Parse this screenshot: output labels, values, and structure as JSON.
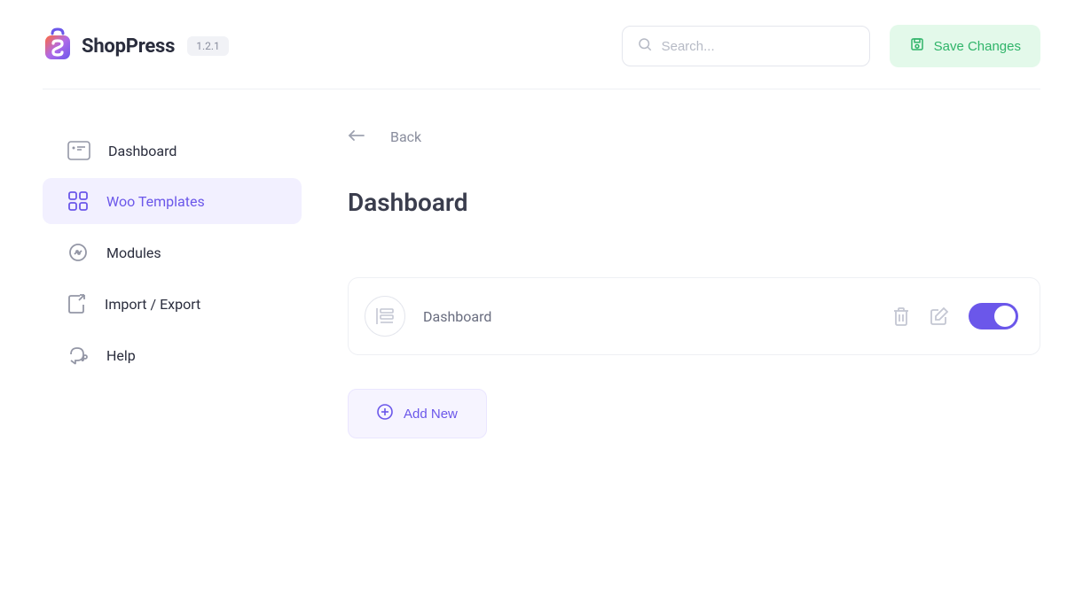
{
  "brand": {
    "name": "ShopPress",
    "version": "1.2.1"
  },
  "header": {
    "search_placeholder": "Search...",
    "save_label": "Save Changes"
  },
  "sidebar": {
    "items": [
      {
        "label": "Dashboard"
      },
      {
        "label": "Woo Templates"
      },
      {
        "label": "Modules"
      },
      {
        "label": "Import / Export"
      },
      {
        "label": "Help"
      }
    ]
  },
  "main": {
    "back_label": "Back",
    "page_title": "Dashboard",
    "template_name": "Dashboard",
    "add_new_label": "Add New"
  }
}
